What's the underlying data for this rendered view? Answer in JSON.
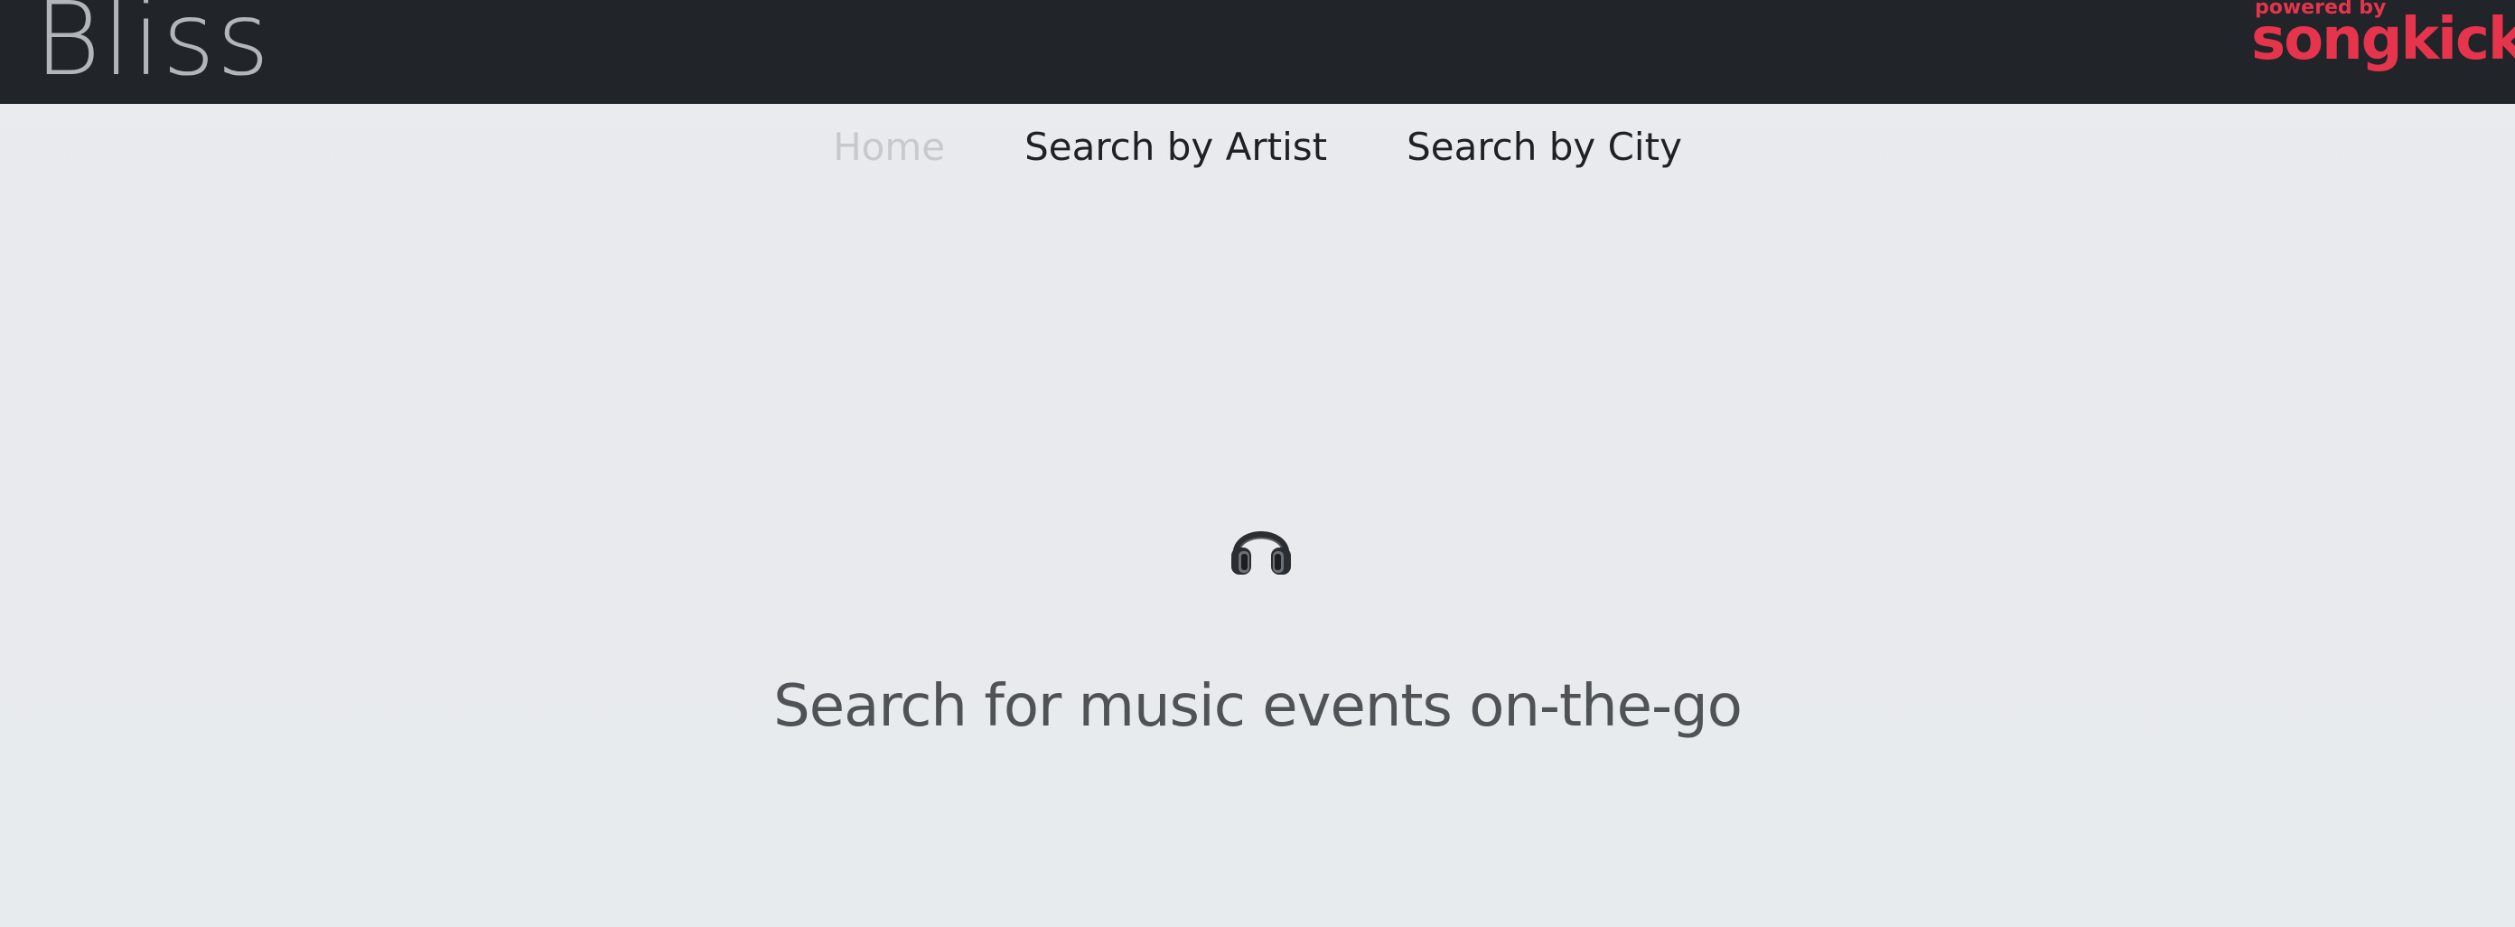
{
  "header": {
    "brand": "Bliss",
    "logo": {
      "powered_by": "powered by",
      "name": "songkick",
      "color": "#e5344c"
    }
  },
  "nav": {
    "items": [
      {
        "label": "Home",
        "active": true
      },
      {
        "label": "Search by Artist",
        "active": false
      },
      {
        "label": "Search by City",
        "active": false
      }
    ]
  },
  "hero": {
    "icon": "headphones-icon",
    "tagline": "Search for music events on-the-go"
  },
  "colors": {
    "topbar": "#212429",
    "brand": "#b2b5ba",
    "background": "#e9ebee",
    "nav_active": "#c7cacd",
    "nav_text": "#1e2126",
    "tagline": "#4f5257"
  }
}
